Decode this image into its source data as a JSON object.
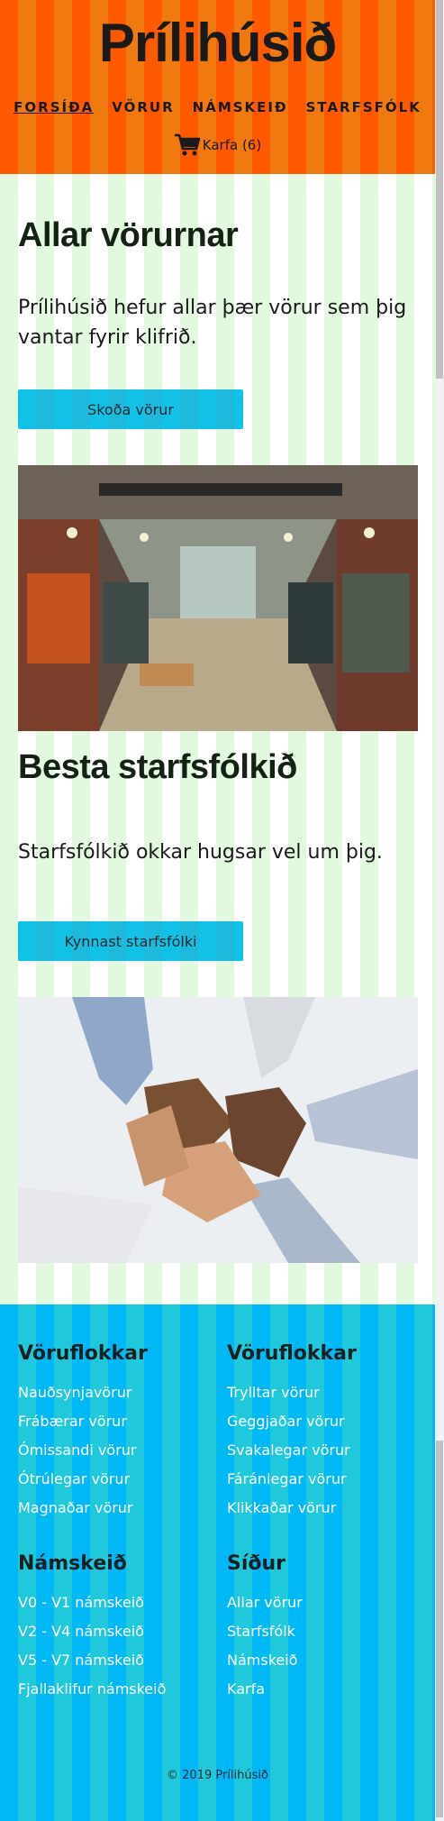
{
  "header": {
    "logo": "Prílihúsið",
    "nav": [
      {
        "label": "FORSÍÐA",
        "active": true
      },
      {
        "label": "VÖRUR",
        "active": false
      },
      {
        "label": "NÁMSKEIÐ",
        "active": false
      },
      {
        "label": "STARFSFÓLK",
        "active": false
      }
    ],
    "cart_label": "Karfa (6)"
  },
  "sections": [
    {
      "title": "Allar vörurnar",
      "text": "Prílihúsið hefur allar þær vörur sem þig vantar fyrir klifrið.",
      "button": "Skoða vörur",
      "image": "store-interior-photo"
    },
    {
      "title": "Besta starfsfólkið",
      "text": "Starfsfólkið okkar hugsar vel um þig.",
      "button": "Kynnast starfsfólki",
      "image": "hands-teamwork-photo"
    }
  ],
  "footer": {
    "columns": [
      {
        "heading": "Vöruflokkar",
        "links": [
          "Nauðsynjavörur",
          "Frábærar vörur",
          "Ómissandi vörur",
          "Ótrúlegar vörur",
          "Magnaðar vörur"
        ]
      },
      {
        "heading": "Vöruflokkar",
        "links": [
          "Trylltar vörur",
          "Geggjaðar vörur",
          "Svakalegar vörur",
          "Fáránlegar vörur",
          "Klikkaðar vörur"
        ]
      },
      {
        "heading": "Námskeið",
        "links": [
          "V0 - V1 námskeið",
          "V2 - V4 námskeið",
          "V5 - V7 námskeið",
          "Fjallaklifur námskeið"
        ]
      },
      {
        "heading": "Síður",
        "links": [
          "Allar vörur",
          "Starfsfólk",
          "Námskeið",
          "Karfa"
        ]
      }
    ],
    "copyright": "© 2019 Prílihúsið"
  },
  "colors": {
    "header_bg": "#ff5a00",
    "main_bg": "#e2f9df",
    "button_bg": "#12c2e6",
    "footer_bg": "#00b8f5"
  }
}
